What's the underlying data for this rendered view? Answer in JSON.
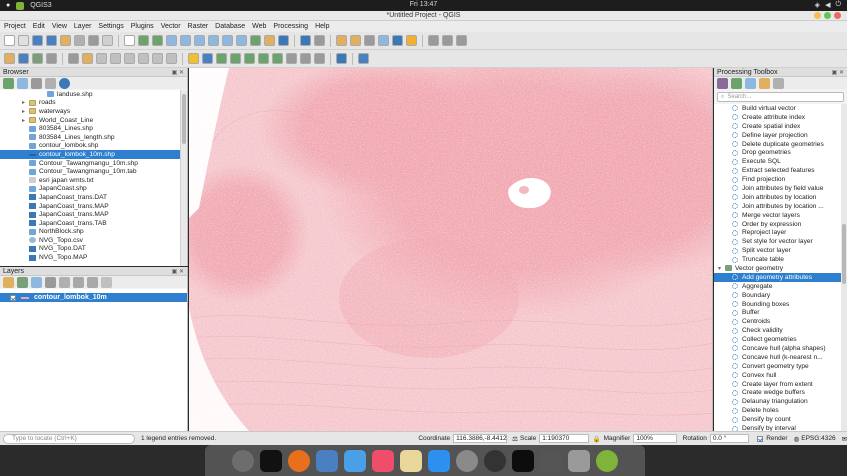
{
  "system": {
    "app_name": "QGIS3",
    "clock": "Fri 13:47"
  },
  "window": {
    "title": "*Untitled Project - QGIS"
  },
  "menu": [
    "Project",
    "Edit",
    "View",
    "Layer",
    "Settings",
    "Plugins",
    "Vector",
    "Raster",
    "Database",
    "Web",
    "Processing",
    "Help"
  ],
  "browser": {
    "title": "Browser",
    "items": [
      {
        "label": "landuse.shp",
        "icon": "vector-file-icon",
        "indent": 2,
        "arrow": ""
      },
      {
        "label": "roads",
        "icon": "folder-icon",
        "indent": 1,
        "arrow": "▸"
      },
      {
        "label": "waterways",
        "icon": "folder-icon",
        "indent": 1,
        "arrow": "▸"
      },
      {
        "label": "World_Coast_Line",
        "icon": "folder-icon",
        "indent": 1,
        "arrow": "▸"
      },
      {
        "label": "803584_Lines.shp",
        "icon": "vector-file-icon",
        "indent": 1,
        "arrow": ""
      },
      {
        "label": "803584_Lines_length.shp",
        "icon": "vector-file-icon",
        "indent": 1,
        "arrow": ""
      },
      {
        "label": "contour_lombok.shp",
        "icon": "vector-file-icon",
        "indent": 1,
        "arrow": ""
      },
      {
        "label": "contour_lombok_10m.shp",
        "icon": "line-layer-icon",
        "indent": 1,
        "arrow": "",
        "selected": true
      },
      {
        "label": "Contour_Tawangmangu_10m.shp",
        "icon": "vector-file-icon",
        "indent": 1,
        "arrow": ""
      },
      {
        "label": "Contour_Tawangmangu_10m.tab",
        "icon": "vector-file-icon",
        "indent": 1,
        "arrow": ""
      },
      {
        "label": "esri japan wmts.txt",
        "icon": "text-file-icon",
        "indent": 1,
        "arrow": ""
      },
      {
        "label": "JapanCoast.shp",
        "icon": "vector-file-icon",
        "indent": 1,
        "arrow": ""
      },
      {
        "label": "JapanCoast_trans.DAT",
        "icon": "raster-file-icon",
        "indent": 1,
        "arrow": ""
      },
      {
        "label": "JapanCoast_trans.MAP",
        "icon": "raster-file-icon",
        "indent": 1,
        "arrow": ""
      },
      {
        "label": "JapanCoast_trans.MAP",
        "icon": "raster-file-icon",
        "indent": 1,
        "arrow": ""
      },
      {
        "label": "JapanCoast_trans.TAB",
        "icon": "raster-file-icon",
        "indent": 1,
        "arrow": ""
      },
      {
        "label": "NorthBlock.shp",
        "icon": "vector-file-icon",
        "indent": 1,
        "arrow": ""
      },
      {
        "label": "NVG_Topo.csv",
        "icon": "globe-icon",
        "indent": 1,
        "arrow": ""
      },
      {
        "label": "NVG_Topo.DAT",
        "icon": "raster-file-icon",
        "indent": 1,
        "arrow": ""
      },
      {
        "label": "NVG_Topo.MAP",
        "icon": "raster-file-icon",
        "indent": 1,
        "arrow": ""
      }
    ]
  },
  "layers": {
    "title": "Layers",
    "items": [
      {
        "label": "contour_lombok_10m",
        "checked": true
      }
    ]
  },
  "map": {
    "contour_color": "#f1a7b0"
  },
  "toolbox": {
    "title": "Processing Toolbox",
    "search_placeholder": "Search...",
    "items": [
      {
        "label": "Build virtual vector"
      },
      {
        "label": "Create attribute index"
      },
      {
        "label": "Create spatial index"
      },
      {
        "label": "Define layer projection"
      },
      {
        "label": "Delete duplicate geometries"
      },
      {
        "label": "Drop geometries"
      },
      {
        "label": "Execute SQL"
      },
      {
        "label": "Extract selected features"
      },
      {
        "label": "Find projection"
      },
      {
        "label": "Join attributes by field value"
      },
      {
        "label": "Join attributes by location"
      },
      {
        "label": "Join attributes by location ..."
      },
      {
        "label": "Merge vector layers"
      },
      {
        "label": "Order by expression"
      },
      {
        "label": "Reproject layer"
      },
      {
        "label": "Set style for vector layer"
      },
      {
        "label": "Split vector layer"
      },
      {
        "label": "Truncate table"
      },
      {
        "label": "Vector geometry",
        "group": true
      },
      {
        "label": "Add geometry attributes",
        "selected": true
      },
      {
        "label": "Aggregate"
      },
      {
        "label": "Boundary"
      },
      {
        "label": "Bounding boxes"
      },
      {
        "label": "Buffer"
      },
      {
        "label": "Centroids"
      },
      {
        "label": "Check validity"
      },
      {
        "label": "Collect geometries"
      },
      {
        "label": "Concave hull (alpha shapes)"
      },
      {
        "label": "Concave hull (k-nearest n..."
      },
      {
        "label": "Convert geometry type"
      },
      {
        "label": "Convex hull"
      },
      {
        "label": "Create layer from extent"
      },
      {
        "label": "Create wedge buffers"
      },
      {
        "label": "Delaunay triangulation"
      },
      {
        "label": "Delete holes"
      },
      {
        "label": "Densify by count"
      },
      {
        "label": "Densify by interval"
      }
    ]
  },
  "status": {
    "locate_placeholder": "Type to locate (Ctrl+K)",
    "message": "1 legend entries removed.",
    "coordinate_label": "Coordinate",
    "coordinate_value": "116.3886,-8.4412",
    "scale_label": "Scale",
    "scale_value": "1:190370",
    "magnifier_label": "Magnifier",
    "magnifier_value": "100%",
    "rotation_label": "Rotation",
    "rotation_value": "0.0 °",
    "render_label": "Render",
    "crs_label": "EPSG:4326"
  }
}
